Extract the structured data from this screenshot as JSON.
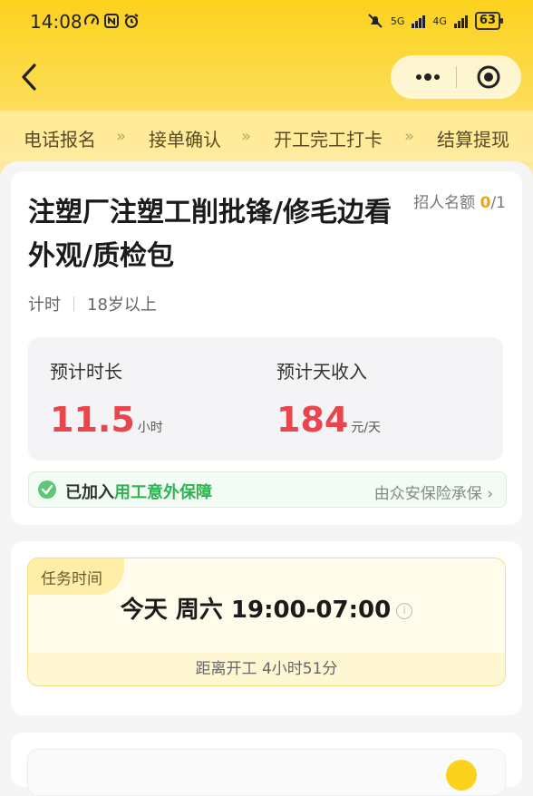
{
  "status_bar": {
    "time": "14:08",
    "network_5g": "5G",
    "network_4g": "4G",
    "battery": "63"
  },
  "steps": [
    "电话报名",
    "接单确认",
    "开工完工打卡",
    "结算提现"
  ],
  "job": {
    "title": "注塑厂注塑工削批锋/修毛边看外观/质检包",
    "quota_label": "招人名额",
    "quota_current": "0",
    "quota_sep": "/",
    "quota_total": "1",
    "tags": [
      "计时",
      "18岁以上"
    ]
  },
  "estimate": {
    "duration_label": "预计时长",
    "duration_value": "11.5",
    "duration_unit": "小时",
    "income_label": "预计天收入",
    "income_value": "184",
    "income_unit": "元/天"
  },
  "insurance": {
    "joined": "已加入",
    "name": "用工意外保障",
    "provider": "由众安保险承保"
  },
  "task_time": {
    "tag": "任务时间",
    "value": "今天 周六 19:00-07:00",
    "countdown": "距离开工 4小时51分"
  },
  "colors": {
    "brand_yellow": "#fcd21c",
    "accent_red": "#e8454c",
    "accent_green": "#2fb352",
    "accent_orange": "#f2a10c"
  }
}
